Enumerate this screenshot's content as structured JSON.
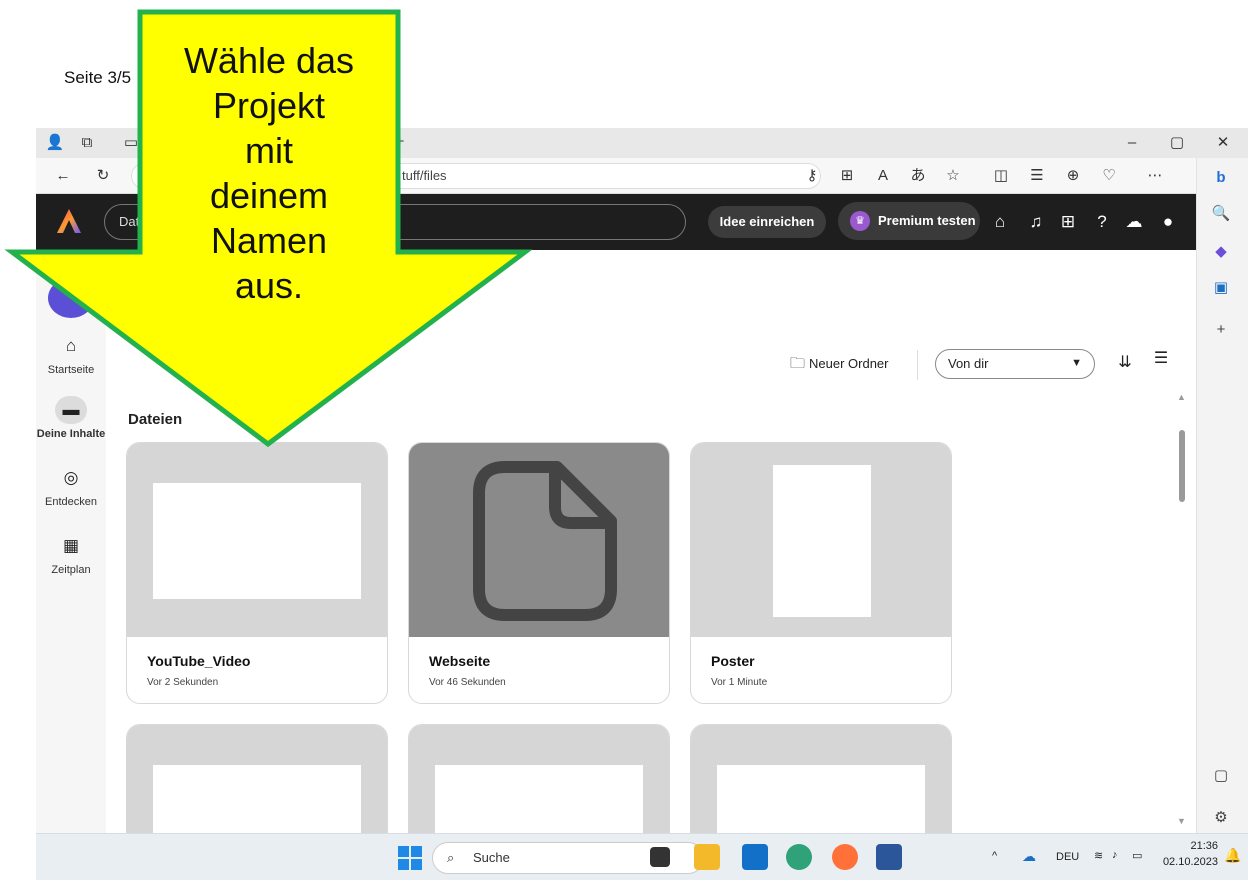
{
  "page_label": "Seite 3/5",
  "callout": {
    "lines": [
      "Wähle das",
      "Projekt",
      "mit",
      "deinem",
      "Namen",
      "aus."
    ]
  },
  "browser": {
    "url": "tuff/files",
    "window_controls": [
      "–",
      "▢",
      "✕"
    ]
  },
  "app_header": {
    "search_text": "Date",
    "idee_label": "Idee einreichen",
    "premium_label": "Premium testen"
  },
  "nav": {
    "items": [
      {
        "label": "Startseite",
        "icon": "home-icon"
      },
      {
        "label": "Deine Inhalte",
        "icon": "folder-icon"
      },
      {
        "label": "Entdecken",
        "icon": "compass-icon"
      },
      {
        "label": "Zeitplan",
        "icon": "calendar-icon"
      }
    ]
  },
  "toolbar": {
    "new_folder": "Neuer Ordner",
    "filter_value": "Von dir"
  },
  "section_title": "Dateien",
  "files": [
    {
      "title": "YouTube_Video",
      "subtitle": "Vor 2 Sekunden"
    },
    {
      "title": "Webseite",
      "subtitle": "Vor 46 Sekunden"
    },
    {
      "title": "Poster",
      "subtitle": "Vor 1 Minute"
    }
  ],
  "taskbar": {
    "search_label": "Suche",
    "lang": "DEU",
    "time": "21:36",
    "date": "02.10.2023"
  },
  "colors": {
    "callout_fill": "#ffff00",
    "callout_border": "#22b14c",
    "header_bg": "#1e1e1e",
    "avatar": "#5b4fd6"
  }
}
